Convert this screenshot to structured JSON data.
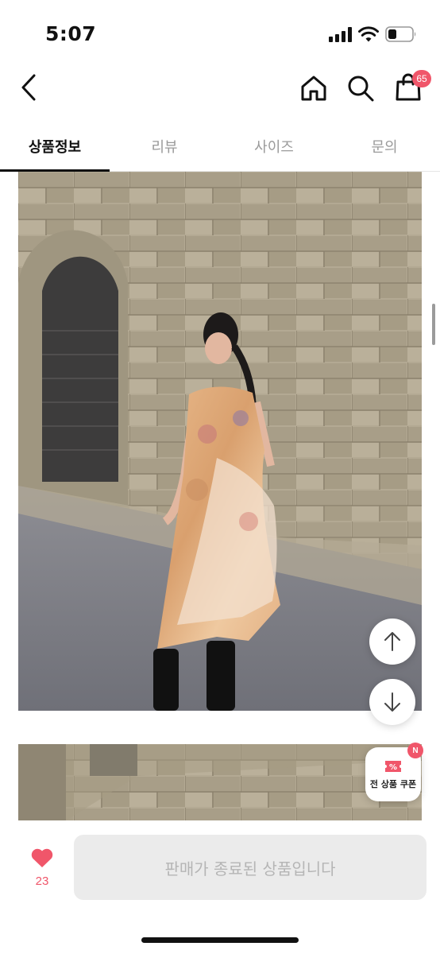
{
  "status": {
    "time": "5:07"
  },
  "header": {
    "cart_count": "65"
  },
  "tabs": [
    {
      "label": "상품정보",
      "active": true
    },
    {
      "label": "리뷰",
      "active": false
    },
    {
      "label": "사이즈",
      "active": false
    },
    {
      "label": "문의",
      "active": false
    }
  ],
  "coupon": {
    "label": "전 상품 쿠폰",
    "badge": "N"
  },
  "bottom": {
    "like_count": "23",
    "purchase_label": "판매가 종료된 상품입니다"
  },
  "colors": {
    "accent": "#f0566a",
    "disabled_bg": "#ebebeb",
    "disabled_text": "#b5b5b5"
  }
}
